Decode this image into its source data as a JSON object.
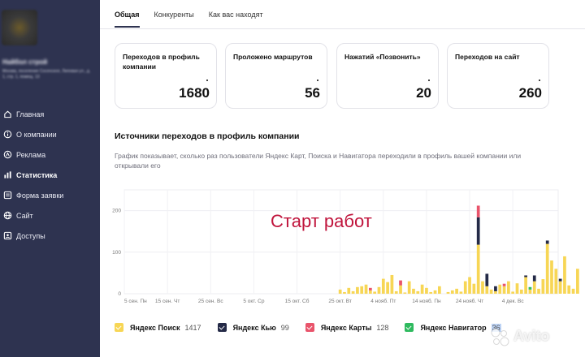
{
  "sidebar": {
    "company_name": "Найбол строй",
    "company_address": "Москва, поселение Сосенское, Липовая ул., д. 1, стр. 1, помещ. 13",
    "items": [
      {
        "label": "Главная",
        "icon": "home-icon"
      },
      {
        "label": "О компании",
        "icon": "info-icon"
      },
      {
        "label": "Реклама",
        "icon": "ad-icon"
      },
      {
        "label": "Статистика",
        "icon": "chart-icon",
        "active": true
      },
      {
        "label": "Форма заявки",
        "icon": "form-icon"
      },
      {
        "label": "Сайт",
        "icon": "globe-icon"
      },
      {
        "label": "Доступы",
        "icon": "key-icon"
      }
    ]
  },
  "tabs": [
    "Общая",
    "Конкуренты",
    "Как вас находят"
  ],
  "cards": [
    {
      "label": "Переходов в профиль компании",
      "value": "1680"
    },
    {
      "label": "Проложено маршрутов",
      "value": "56"
    },
    {
      "label": "Нажатий «Позвонить»",
      "value": "20"
    },
    {
      "label": "Переходов на сайт",
      "value": "260"
    }
  ],
  "section": {
    "title": "Источники переходов в профиль компании",
    "description": "График показывает, сколько раз пользователи Яндекс Карт, Поиска и Навигатора переходили в профиль вашей компании или открывали его"
  },
  "chart_data": {
    "type": "bar",
    "stacked": true,
    "annotation": "Старт работ",
    "yticks": [
      "200",
      "100",
      "0"
    ],
    "ylim": [
      0,
      250
    ],
    "xticks": [
      "5 сен. Пн",
      "15 сен. Чт",
      "25 сен. Вс",
      "5 окт. Ср",
      "15 окт. Сб",
      "25 окт. Вт",
      "4 нояб. Пт",
      "14 нояб. Пн",
      "24 нояб. Чт",
      "4 дек. Вс"
    ],
    "colors": {
      "search": "#f7d655",
      "q": "#242a47",
      "maps": "#e9546b",
      "navigator": "#2fba5f"
    },
    "start_index": 50,
    "series": [
      {
        "name": "Яндекс Поиск",
        "key": "search",
        "values": [
          10,
          4,
          14,
          6,
          16,
          18,
          22,
          8,
          5,
          16,
          36,
          28,
          45,
          6,
          20,
          3,
          30,
          12,
          6,
          22,
          14,
          4,
          8,
          18,
          0,
          4,
          8,
          12,
          5,
          30,
          40,
          24,
          118,
          30,
          18,
          10,
          6,
          22,
          18,
          30,
          5,
          25,
          10,
          40,
          10,
          30,
          12,
          35,
          120,
          80,
          60,
          30,
          90,
          20,
          12,
          60
        ]
      },
      {
        "name": "Яндекс Кью",
        "key": "q",
        "values": [
          0,
          0,
          0,
          0,
          0,
          0,
          0,
          0,
          0,
          0,
          0,
          0,
          0,
          0,
          0,
          0,
          0,
          0,
          0,
          0,
          0,
          0,
          0,
          0,
          0,
          0,
          0,
          0,
          0,
          0,
          0,
          0,
          66,
          0,
          30,
          0,
          12,
          0,
          0,
          0,
          0,
          0,
          0,
          4,
          0,
          14,
          0,
          0,
          8,
          0,
          0,
          6,
          0,
          0,
          0,
          0
        ]
      },
      {
        "name": "Яндекс Карты",
        "key": "maps",
        "values": [
          0,
          0,
          0,
          0,
          0,
          0,
          0,
          6,
          0,
          0,
          0,
          0,
          0,
          0,
          12,
          0,
          0,
          0,
          0,
          0,
          0,
          0,
          0,
          0,
          0,
          0,
          0,
          0,
          0,
          0,
          0,
          0,
          28,
          0,
          0,
          0,
          0,
          0,
          6,
          0,
          0,
          0,
          0,
          0,
          0,
          0,
          0,
          0,
          0,
          0,
          0,
          0,
          0,
          0,
          0,
          0
        ]
      },
      {
        "name": "Яндекс Навигатор",
        "key": "navigator",
        "values": [
          0,
          0,
          0,
          0,
          0,
          0,
          0,
          0,
          0,
          0,
          0,
          0,
          0,
          0,
          0,
          0,
          0,
          0,
          0,
          0,
          0,
          0,
          0,
          0,
          0,
          0,
          0,
          0,
          0,
          0,
          0,
          0,
          0,
          0,
          0,
          0,
          0,
          0,
          0,
          0,
          0,
          0,
          0,
          0,
          6,
          0,
          0,
          0,
          0,
          0,
          0,
          0,
          0,
          0,
          0,
          0
        ]
      }
    ]
  },
  "legend": [
    {
      "name": "Яндекс Поиск",
      "value": "1417",
      "color": "#f7d655"
    },
    {
      "name": "Яндекс Кью",
      "value": "99",
      "color": "#242a47"
    },
    {
      "name": "Яндекс Карты",
      "value": "128",
      "color": "#e9546b"
    },
    {
      "name": "Яндекс Навигатор",
      "value": "36",
      "color": "#2fba5f",
      "highlight": true
    }
  ],
  "watermark": "Avito"
}
